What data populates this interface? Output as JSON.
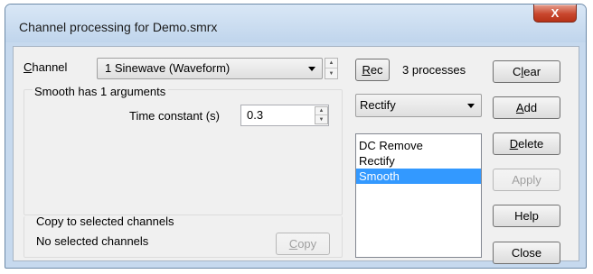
{
  "window": {
    "title": "Channel processing for Demo.smrx",
    "close_glyph": "X"
  },
  "channel": {
    "label_accel": "C",
    "label_rest": "hannel",
    "selected": "1 Sinewave (Waveform)"
  },
  "smooth_group": {
    "caption": "Smooth has 1 arguments",
    "time_constant_label": "Time constant (s)",
    "time_constant_value": "0.3"
  },
  "copy_group": {
    "caption": "Copy to selected channels",
    "status": "No selected channels",
    "copy_accel": "C",
    "copy_rest": "opy"
  },
  "rec": {
    "accel": "R",
    "rest": "ec"
  },
  "process_count": "3 processes",
  "process_type": {
    "selected": "Rectify"
  },
  "process_list": {
    "items": [
      {
        "label": "DC Remove",
        "selected": false
      },
      {
        "label": "Rectify",
        "selected": false
      },
      {
        "label": "Smooth",
        "selected": true
      }
    ]
  },
  "buttons": {
    "clear": {
      "pre": "C",
      "accel": "l",
      "post": "ear"
    },
    "add": {
      "pre": "",
      "accel": "A",
      "post": "dd"
    },
    "delete": {
      "pre": "",
      "accel": "D",
      "post": "elete"
    },
    "apply": {
      "label": "Apply",
      "enabled": false
    },
    "help": {
      "label": "Help"
    },
    "close": {
      "label": "Close"
    }
  },
  "colors": {
    "selection": "#3399ff",
    "title_bar": "#c6d9ee",
    "close_button": "#c9472e"
  }
}
